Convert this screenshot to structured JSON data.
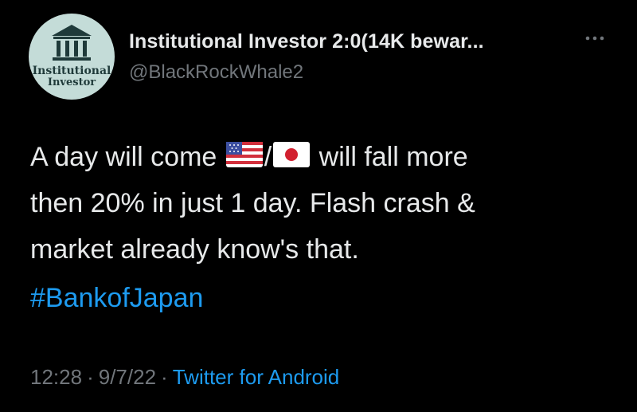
{
  "account": {
    "display_name": "Institutional Investor 2:0(14K bewar...",
    "handle": "@BlackRockWhale2",
    "avatar_text_line1": "Institutional",
    "avatar_text_line2": "Investor",
    "avatar_background": "#c4dcd8"
  },
  "tweet": {
    "line1_before": "A day will come ",
    "flag1": "us-flag-icon",
    "slash": "/",
    "flag2": "japan-flag-icon",
    "line1_after": " will fall more",
    "line2": "then 20% in just 1 day. Flash crash &",
    "line3": "market already know's that.",
    "hashtag": "#BankofJapan"
  },
  "meta": {
    "time": "12:28",
    "date": "9/7/22",
    "separator": "·",
    "source": "Twitter for Android"
  },
  "colors": {
    "background": "#000000",
    "text": "#e7e9ea",
    "muted": "#71767b",
    "link": "#1d9bf0"
  },
  "icons": {
    "more": "more-dots-icon",
    "avatar_glyph": "bank-building-icon"
  }
}
